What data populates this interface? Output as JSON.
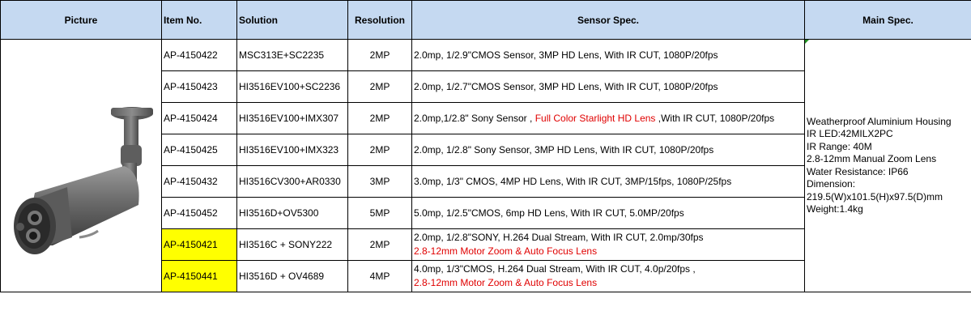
{
  "headers": {
    "picture": "Picture",
    "item_no": "Item No.",
    "solution": "Solution",
    "resolution": "Resolution",
    "sensor_spec": "Sensor Spec.",
    "main_spec": "Main Spec."
  },
  "rows": [
    {
      "item": "AP-4150422",
      "solution": "MSC313E+SC2235",
      "resolution": "2MP",
      "sensor_a": "2.0mp, 1/2.9\"CMOS Sensor, 3MP HD Lens, With IR CUT, 1080P/20fps",
      "sensor_red": "",
      "sensor_b": ""
    },
    {
      "item": "AP-4150423",
      "solution": "HI3516EV100+SC2236",
      "resolution": "2MP",
      "sensor_a": "2.0mp, 1/2.7\"CMOS Sensor, 3MP HD Lens, With IR CUT, 1080P/20fps",
      "sensor_red": "",
      "sensor_b": ""
    },
    {
      "item": "AP-4150424",
      "solution": "HI3516EV100+IMX307",
      "resolution": "2MP",
      "sensor_a": "2.0mp,1/2.8\" Sony Sensor , ",
      "sensor_red": "Full Color Starlight HD Lens",
      "sensor_b": " ,With IR CUT, 1080P/20fps"
    },
    {
      "item": "AP-4150425",
      "solution": "HI3516EV100+IMX323",
      "resolution": "2MP",
      "sensor_a": "2.0mp, 1/2.8\" Sony Sensor, 3MP HD Lens, With IR CUT, 1080P/20fps",
      "sensor_red": "",
      "sensor_b": ""
    },
    {
      "item": "AP-4150432",
      "solution": "HI3516CV300+AR0330",
      "resolution": "3MP",
      "sensor_a": "3.0mp, 1/3\" CMOS, 4MP  HD Lens, With IR CUT, 3MP/15fps, 1080P/25fps",
      "sensor_red": "",
      "sensor_b": ""
    },
    {
      "item": "AP-4150452",
      "solution": "HI3516D+OV5300",
      "resolution": "5MP",
      "sensor_a": "5.0mp, 1/2.5\"CMOS, 6mp HD Lens, With IR CUT,  5.0MP/20fps",
      "sensor_red": "",
      "sensor_b": ""
    },
    {
      "item": "AP-4150421",
      "solution": "HI3516C + SONY222",
      "resolution": "2MP",
      "sensor_a": "2.0mp, 1/2.8\"SONY, H.264 Dual Stream, With  IR CUT, 2.0mp/30fps",
      "sensor_red": "2.8-12mm Motor Zoom & Auto Focus Lens",
      "sensor_b": ""
    },
    {
      "item": "AP-4150441",
      "solution": "HI3516D + OV4689",
      "resolution": "4MP",
      "sensor_a": "4.0mp, 1/3\"CMOS, H.264 Dual Stream, With  IR CUT, 4.0p/20fps ,",
      "sensor_red": "2.8-12mm Motor Zoom & Auto Focus Lens",
      "sensor_b": ""
    }
  ],
  "main_spec_lines": [
    "Weatherproof Aluminium Housing",
    "IR LED:42MILX2PC",
    "IR Range: 40M",
    "2.8-12mm Manual Zoom Lens",
    "Water Resistance: IP66",
    "Dimension:",
    "219.5(W)x101.5(H)x97.5(D)mm",
    "Weight:1.4kg"
  ],
  "colors": {
    "header_bg": "#c5d9f1",
    "highlight": "#ffff00",
    "red_text": "#e00000",
    "camera_body": "#6a6a6a"
  },
  "icons": [
    "bullet-camera-image"
  ]
}
